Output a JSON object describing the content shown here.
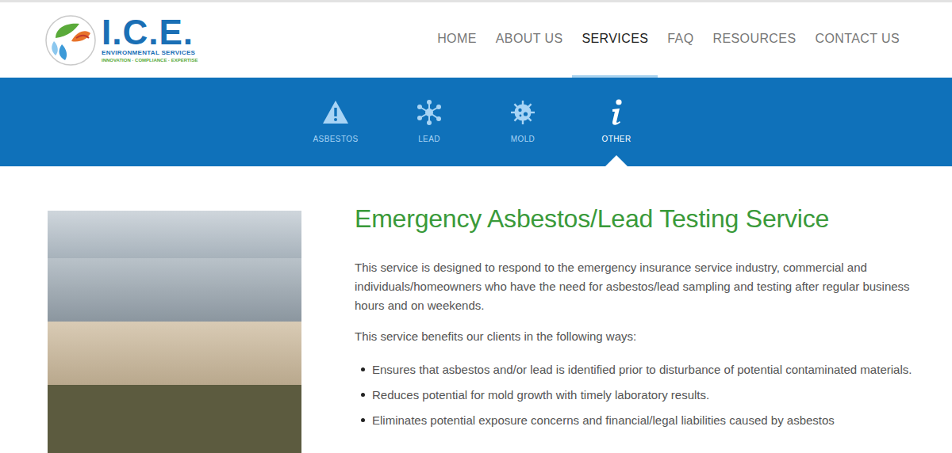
{
  "logo": {
    "name": "I.C.E.",
    "subtitle": "ENVIRONMENTAL SERVICES",
    "tagline": "INNOVATION · COMPLIANCE · EXPERTISE"
  },
  "nav": [
    {
      "label": "HOME",
      "selected": false
    },
    {
      "label": "ABOUT US",
      "selected": false
    },
    {
      "label": "SERVICES",
      "selected": true
    },
    {
      "label": "FAQ",
      "selected": false
    },
    {
      "label": "RESOURCES",
      "selected": false
    },
    {
      "label": "CONTACT US",
      "selected": false
    }
  ],
  "service_tabs": [
    {
      "label": "ASBESTOS",
      "kind": "warning",
      "selected": false
    },
    {
      "label": "LEAD",
      "kind": "molecule",
      "selected": false
    },
    {
      "label": "MOLD",
      "kind": "virus",
      "selected": false
    },
    {
      "label": "OTHER",
      "kind": "info",
      "selected": true
    }
  ],
  "page": {
    "title": "Emergency Asbestos/Lead Testing Service",
    "paragraphs": [
      "This service is designed to respond to the emergency insurance service industry, commercial and individuals/homeowners who have the need for asbestos/lead sampling and testing after regular business hours and on weekends.",
      "This service benefits our clients in the following ways:"
    ],
    "benefits": [
      "Ensures that asbestos and/or lead is identified prior to disturbance of potential contaminated materials.",
      "Reduces potential for mold growth with timely laboratory results.",
      "Eliminates potential exposure concerns and financial/legal liabilities caused by asbestos"
    ]
  }
}
